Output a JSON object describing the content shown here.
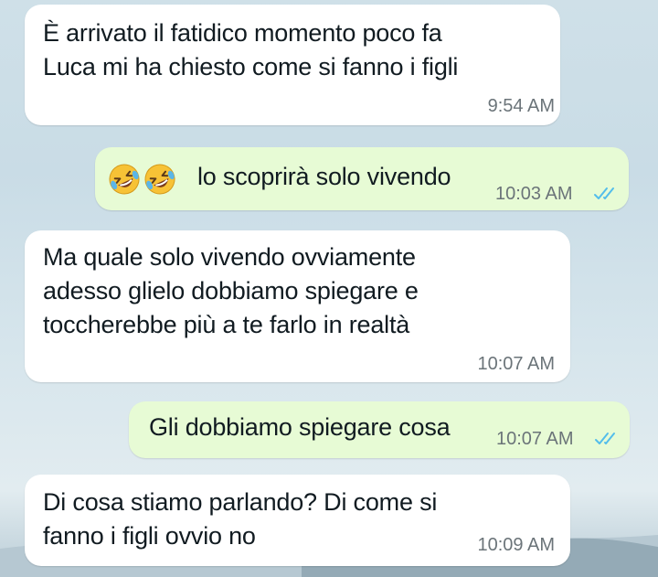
{
  "messages": [
    {
      "direction": "incoming",
      "text": "È arrivato il fatidico momento poco fa\nLuca mi ha chiesto come si fanno i figli",
      "time": "9:54 AM"
    },
    {
      "direction": "outgoing",
      "emoji": [
        "rolling-on-floor-laughing",
        "rolling-on-floor-laughing"
      ],
      "text": "lo scoprirà solo vivendo",
      "time": "10:03 AM",
      "status": "read"
    },
    {
      "direction": "incoming",
      "text": "Ma quale solo vivendo ovviamente\nadesso glielo dobbiamo spiegare e\ntoccherebbe più a te farlo in realtà",
      "time": "10:07 AM"
    },
    {
      "direction": "outgoing",
      "text": "Gli dobbiamo spiegare cosa",
      "time": "10:07 AM",
      "status": "read"
    },
    {
      "direction": "incoming",
      "text": "Di cosa stiamo parlando? Di come si\nfanno i figli ovvio no",
      "time": "10:09 AM"
    }
  ],
  "colors": {
    "incoming_bubble": "#ffffff",
    "outgoing_bubble": "#e7fbd5",
    "timestamp": "#6b7479",
    "read_ticks": "#53bdeb",
    "text": "#111b21"
  }
}
